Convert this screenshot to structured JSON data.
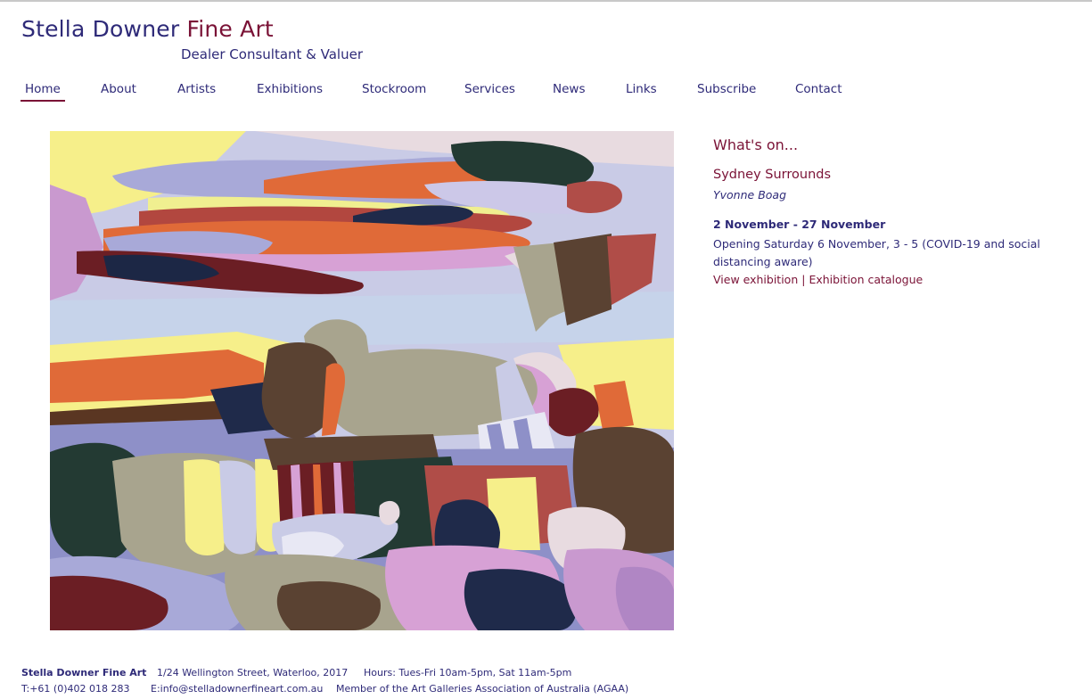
{
  "site": {
    "name_part1": "Stella Downer",
    "name_part2": "Fine Art",
    "tagline": "Dealer Consultant & Valuer"
  },
  "nav": {
    "items": [
      {
        "label": "Home",
        "active": true
      },
      {
        "label": "About"
      },
      {
        "label": "Artists"
      },
      {
        "label": "Exhibitions"
      },
      {
        "label": "Stockroom"
      },
      {
        "label": "Services"
      },
      {
        "label": "News"
      },
      {
        "label": "Links"
      },
      {
        "label": "Subscribe"
      },
      {
        "label": "Contact"
      }
    ]
  },
  "artwork": {
    "icon": "abstract-painting-image"
  },
  "whats_on": {
    "heading": "What's on...",
    "exhibition_title": "Sydney Surrounds",
    "artist": "Yvonne Boag",
    "dates": "2 November - 27 November",
    "opening": "Opening Saturday 6 November, 3 - 5 (COVID-19 and social distancing aware)",
    "link_view": "View exhibition",
    "separator": "|",
    "link_catalogue": "Exhibition catalogue"
  },
  "footer": {
    "business_name": "Stella Downer Fine Art",
    "address": "1/24 Wellington Street, Waterloo, 2017",
    "hours": "Hours: Tues-Fri 10am-5pm, Sat 11am-5pm",
    "phone": "T:+61 (0)402 018 283",
    "email": "E:info@stelladownerfineart.com.au",
    "membership": "Member of the Art Galleries Association of Australia (AGAA)"
  },
  "colors": {
    "brand_blue": "#2e2a78",
    "brand_maroon": "#7a1236"
  }
}
